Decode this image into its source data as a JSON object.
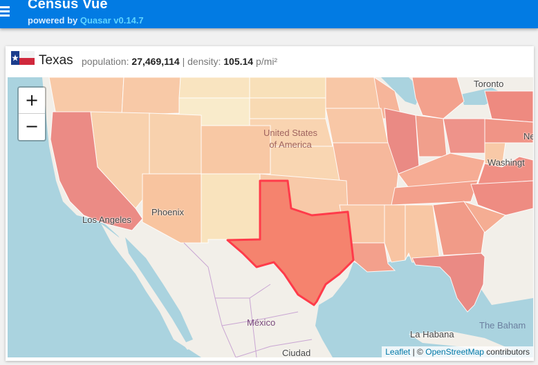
{
  "header": {
    "title": "Census Vue",
    "subtitle_prefix": "powered by",
    "subtitle_link": "Quasar v0.14.7"
  },
  "state": {
    "name": "Texas",
    "population_label": "population:",
    "population": "27,469,114",
    "separator": "|",
    "density_label": "density:",
    "density": "105.14",
    "density_unit": "p/mi²"
  },
  "map": {
    "zoom_in": "+",
    "zoom_out": "−",
    "labels": {
      "country_line1": "United States",
      "country_line2": "of America",
      "toronto": "Toronto",
      "washington": "Washingt",
      "new_york_partial": "Ne",
      "phoenix": "Phoenix",
      "los_angeles": "Los Angeles",
      "mexico": "México",
      "ciudad": "Ciudad",
      "la_habana": "La Habana",
      "bahamas": "The Baham"
    },
    "attribution": {
      "leaflet": "Leaflet",
      "sep": "| ©",
      "osm": "OpenStreetMap",
      "contributors": "contributors"
    },
    "colors": {
      "ocean": "#aad3df",
      "land": "#f2efe9",
      "highlight": "#f5836e",
      "highlight_border": "#ff3b4a"
    }
  }
}
